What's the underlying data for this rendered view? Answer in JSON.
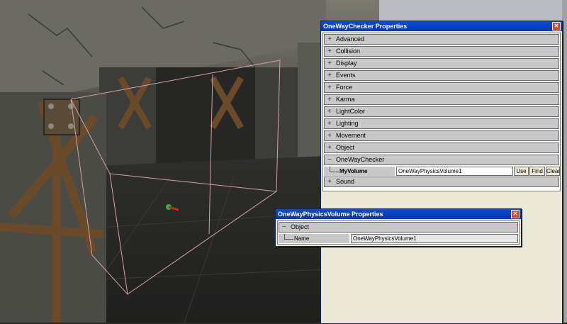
{
  "oneway_window": {
    "title": "OneWayChecker Properties",
    "close": "✕",
    "categories": [
      {
        "label": "Advanced",
        "expander": "+"
      },
      {
        "label": "Collision",
        "expander": "+"
      },
      {
        "label": "Display",
        "expander": "+"
      },
      {
        "label": "Events",
        "expander": "+"
      },
      {
        "label": "Force",
        "expander": "+"
      },
      {
        "label": "Karma",
        "expander": "+"
      },
      {
        "label": "LightColor",
        "expander": "+"
      },
      {
        "label": "Lighting",
        "expander": "+"
      },
      {
        "label": "Movement",
        "expander": "+"
      },
      {
        "label": "Object",
        "expander": "+"
      },
      {
        "label": "OneWayChecker",
        "expander": "−"
      },
      {
        "label": "Sound",
        "expander": "+"
      }
    ],
    "property": {
      "name": "MyVolume",
      "value": "OneWayPhysicsVolume1",
      "use_label": "Use",
      "find_label": "Find",
      "clear_label": "Clear"
    }
  },
  "volume_window": {
    "title": "OneWayPhysicsVolume Properties",
    "close": "✕",
    "category": {
      "label": "Object",
      "expander": "−"
    },
    "property": {
      "name": "Name",
      "value": "OneWayPhysicsVolume1"
    }
  }
}
